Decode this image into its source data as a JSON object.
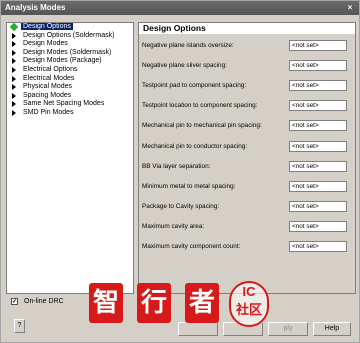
{
  "window": {
    "title": "Analysis Modes",
    "close_glyph": "×"
  },
  "tree": {
    "items": [
      {
        "label": "Design Options",
        "icon": "diamond-icon",
        "selected": true
      },
      {
        "label": "Design Options (Soldermask)",
        "icon": "arrow-icon",
        "selected": false
      },
      {
        "label": "Design Modes",
        "icon": "arrow-icon",
        "selected": false
      },
      {
        "label": "Design Modes (Soldermask)",
        "icon": "arrow-icon",
        "selected": false
      },
      {
        "label": "Design Modes (Package)",
        "icon": "arrow-icon",
        "selected": false
      },
      {
        "label": "Electrical Options",
        "icon": "arrow-icon",
        "selected": false
      },
      {
        "label": "Electrical Modes",
        "icon": "arrow-icon",
        "selected": false
      },
      {
        "label": "Physical Modes",
        "icon": "arrow-icon",
        "selected": false
      },
      {
        "label": "Spacing Modes",
        "icon": "arrow-icon",
        "selected": false
      },
      {
        "label": "Same Net Spacing Modes",
        "icon": "arrow-icon",
        "selected": false
      },
      {
        "label": "SMD Pin Modes",
        "icon": "arrow-icon",
        "selected": false
      }
    ]
  },
  "content": {
    "header": "Design Options",
    "fields": [
      {
        "label": "Negative plane islands oversize:",
        "value": "<not set>"
      },
      {
        "label": "Negative plane sliver spacing:",
        "value": "<not set>"
      },
      {
        "label": "Testpoint pad to component spacing:",
        "value": "<not set>"
      },
      {
        "label": "Testpoint location to component spacing:",
        "value": "<not set>"
      },
      {
        "label": "Mechanical pin to mechanical pin spacing:",
        "value": "<not set>"
      },
      {
        "label": "Mechanical pin to conductor spacing:",
        "value": "<not set>"
      },
      {
        "label": "BB Via layer separation:",
        "value": "<not set>"
      },
      {
        "label": "Minimum metal to metal spacing:",
        "value": "<not set>"
      },
      {
        "label": "Package to Cavity spacing:",
        "value": "<not set>"
      },
      {
        "label": "Maximum cavity area:",
        "value": "<not set>"
      },
      {
        "label": "Maximum cavity component count:",
        "value": "<not set>"
      }
    ]
  },
  "footer": {
    "online_drc_label": "On-line DRC",
    "online_drc_checked": true,
    "check_glyph": "✓",
    "help_q": "?",
    "ok_label": "",
    "cancel_label": "",
    "apply_label": "ply",
    "help_label": "Help"
  },
  "watermark": {
    "chars": [
      "智",
      "行",
      "者"
    ],
    "ic_text": "IC",
    "community_text": "社区",
    "color": "#d61a1a"
  }
}
